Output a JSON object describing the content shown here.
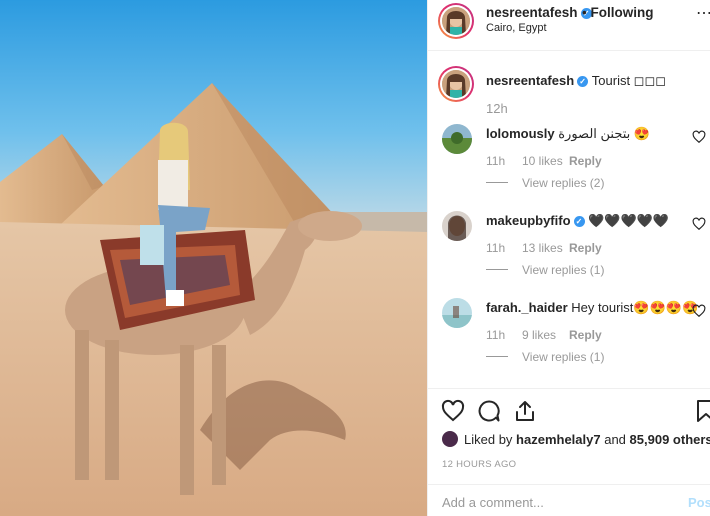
{
  "header": {
    "username": "nesreentafesh",
    "separator": "•",
    "follow_status": "Following",
    "location": "Cairo, Egypt",
    "more_icon": "more-icon"
  },
  "caption": {
    "username": "nesreentafesh",
    "text": "Tourist ◻◻◻",
    "time": "12h"
  },
  "comments": [
    {
      "username": "lolomously",
      "text": "بتجنن الصورة 😍",
      "time": "11h",
      "likes": "10 likes",
      "reply": "Reply",
      "view_replies": "View replies (2)"
    },
    {
      "username": "makeupbyfifo",
      "text": "🖤🖤🖤🖤🖤",
      "time": "11h",
      "likes": "13 likes",
      "reply": "Reply",
      "view_replies": "View replies (1)"
    },
    {
      "username": "farah._haider",
      "text": "Hey tourist😍😍😍😍",
      "time": "11h",
      "likes": "9 likes",
      "reply": "Reply",
      "view_replies": "View replies (1)"
    }
  ],
  "actions": {
    "liked_by_prefix": "Liked by",
    "liked_by_user": "hazemhelaly7",
    "liked_by_and": "and",
    "liked_by_others": "85,909 others",
    "timestamp": "12 HOURS AGO"
  },
  "add_comment": {
    "placeholder": "Add a comment...",
    "post_label": "Post"
  },
  "colors": {
    "verified": "#3897f0",
    "text": "#262626",
    "muted": "#999999",
    "border": "#efefef",
    "post_disabled": "#b2dffc"
  }
}
